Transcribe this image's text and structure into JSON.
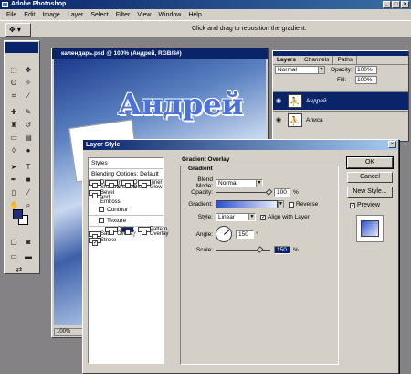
{
  "app": {
    "title": "Adobe Photoshop"
  },
  "menu": [
    "File",
    "Edit",
    "Image",
    "Layer",
    "Select",
    "Filter",
    "View",
    "Window",
    "Help"
  ],
  "options": {
    "hint": "Click and drag to reposition the gradient."
  },
  "document": {
    "title": "календарь.psd @ 100% (Андрей, RGB/8#)",
    "zoom": "100%",
    "canvas_text": "Андрей"
  },
  "layers_panel": {
    "tabs": [
      "Layers",
      "Channels",
      "Paths"
    ],
    "blend_mode": "Normal",
    "opacity_label": "Opacity:",
    "opacity": "100%",
    "fill_label": "Fill:",
    "fill": "100%",
    "items": [
      {
        "name": "Андрей",
        "selected": true
      },
      {
        "name": "Алиса",
        "selected": false
      }
    ]
  },
  "dialog": {
    "title": "Layer Style",
    "styles": [
      {
        "label": "Styles",
        "type": "head"
      },
      {
        "label": "Blending Options: Default",
        "type": "head"
      },
      {
        "label": "Drop Shadow",
        "type": "chk",
        "checked": false
      },
      {
        "label": "Inner Shadow",
        "type": "chk",
        "checked": false
      },
      {
        "label": "Outer Glow",
        "type": "chk",
        "checked": false
      },
      {
        "label": "Inner Glow",
        "type": "chk",
        "checked": false
      },
      {
        "label": "Bevel and Emboss",
        "type": "chk",
        "checked": false
      },
      {
        "label": "Contour",
        "type": "sub",
        "checked": false
      },
      {
        "label": "Texture",
        "type": "sub",
        "checked": false
      },
      {
        "label": "Satin",
        "type": "chk",
        "checked": false
      },
      {
        "label": "Color Overlay",
        "type": "chk",
        "checked": false
      },
      {
        "label": "Gradient Overlay",
        "type": "chk",
        "checked": true,
        "selected": true
      },
      {
        "label": "Pattern Overlay",
        "type": "chk",
        "checked": false
      },
      {
        "label": "Stroke",
        "type": "chk",
        "checked": true
      }
    ],
    "group_title": "Gradient Overlay",
    "sub_title": "Gradient",
    "blend_mode_label": "Blend Mode:",
    "blend_mode": "Normal",
    "opacity_label": "Opacity:",
    "opacity": "100",
    "percent": "%",
    "gradient_label": "Gradient:",
    "reverse_label": "Reverse",
    "style_label": "Style:",
    "style": "Linear",
    "align_label": "Align with Layer",
    "angle_label": "Angle:",
    "angle": "150",
    "degree": "°",
    "scale_label": "Scale:",
    "scale": "150",
    "buttons": {
      "ok": "OK",
      "cancel": "Cancel",
      "new_style": "New Style...",
      "preview": "Preview"
    }
  }
}
